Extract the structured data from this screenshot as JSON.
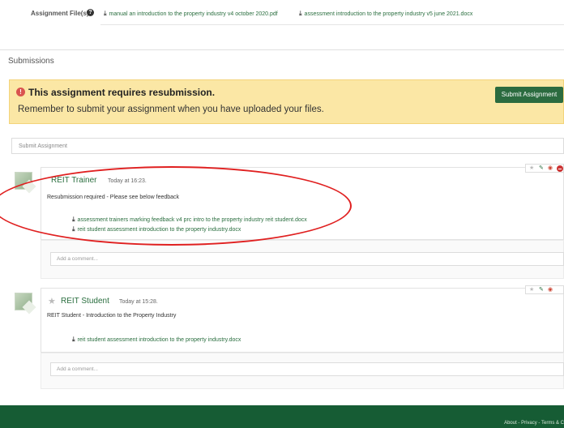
{
  "assignment_files": {
    "label": "Assignment File(s)",
    "files": [
      "manual an introduction to the property industry v4 october 2020.pdf",
      "assessment introduction to the property industry v5 june 2021.docx"
    ]
  },
  "submissions": {
    "heading": "Submissions",
    "alert": {
      "title": "This assignment requires resubmission.",
      "message": "Remember to submit your assignment when you have uploaded your files.",
      "button_label": "Submit Assignment"
    },
    "submit_bar_text": "Submit Assignment"
  },
  "posts": [
    {
      "author": "REIT Trainer",
      "time": "Today at 16:23.",
      "text": "Resubmission required - Please see below feedback",
      "attachments": [
        "assessment trainers marking feedback v4 prc intro to the property industry reit student.docx",
        "reit student assessment introduction to the property industry.docx"
      ],
      "comment_placeholder": "Add a comment..."
    },
    {
      "author": "REIT Student",
      "time": "Today at 15:28.",
      "text": "REIT Student - Introduction to the Property Industry",
      "attachments": [
        "reit student assessment introduction to the property industry.docx"
      ],
      "comment_placeholder": "Add a comment..."
    }
  ],
  "footer": {
    "links": "About - Privacy - Terms & C"
  },
  "colors": {
    "accent_green": "#2b6b3f",
    "alert_yellow": "#fbe7a5",
    "footer_green": "#165c34",
    "highlight_red": "#e02020"
  }
}
